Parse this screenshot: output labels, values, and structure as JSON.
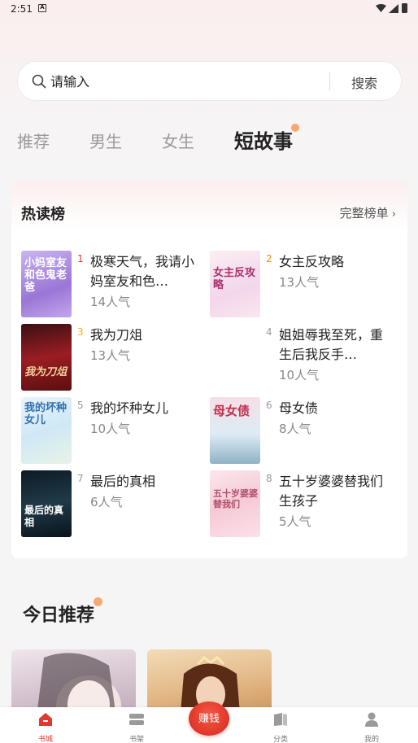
{
  "status_bar": {
    "time": "2:51",
    "notification_icon": "A"
  },
  "search": {
    "placeholder": "请输入",
    "button_label": "搜索"
  },
  "tabs": [
    {
      "label": "推荐",
      "active": false
    },
    {
      "label": "男生",
      "active": false
    },
    {
      "label": "女生",
      "active": false
    },
    {
      "label": "短故事",
      "active": true
    }
  ],
  "hot_list": {
    "title": "热读榜",
    "more_label": "完整榜单",
    "items": [
      {
        "rank": "1",
        "title": "极寒天气，我请小妈室友和色…",
        "popularity": "14人气",
        "cover_text": "小妈室友 和色鬼老爸",
        "rank_color": "#e03a2e"
      },
      {
        "rank": "2",
        "title": "女主反攻略",
        "popularity": "13人气",
        "cover_text": "女主反攻略",
        "rank_color": "#f08c1e"
      },
      {
        "rank": "3",
        "title": "我为刀俎",
        "popularity": "13人气",
        "cover_text": "我为刀俎",
        "rank_color": "#f0b41e"
      },
      {
        "rank": "4",
        "title": "姐姐辱我至死，重生后我反手…",
        "popularity": "10人气",
        "cover_text": "",
        "rank_color": "#999999"
      },
      {
        "rank": "5",
        "title": "我的坏种女儿",
        "popularity": "10人气",
        "cover_text": "我的坏种女儿",
        "rank_color": "#999999"
      },
      {
        "rank": "6",
        "title": "母女债",
        "popularity": "8人气",
        "cover_text": "母女债",
        "rank_color": "#999999"
      },
      {
        "rank": "7",
        "title": "最后的真相",
        "popularity": "6人气",
        "cover_text": "最后的真相",
        "rank_color": "#999999"
      },
      {
        "rank": "8",
        "title": "五十岁婆婆替我们生孩子",
        "popularity": "5人气",
        "cover_text": "五十岁婆婆 替我们",
        "rank_color": "#999999"
      }
    ]
  },
  "today": {
    "title": "今日推荐"
  },
  "bottom_nav": {
    "items": [
      {
        "label": "书城",
        "icon": "store-icon",
        "active": true
      },
      {
        "label": "书架",
        "icon": "bookshelf-icon",
        "active": false
      },
      {
        "label": "分类",
        "icon": "category-icon",
        "active": false
      },
      {
        "label": "我的",
        "icon": "profile-icon",
        "active": false
      }
    ],
    "earn_label": "赚钱"
  },
  "colors": {
    "accent": "#e03a2e",
    "tab_dot": "#f6a872"
  }
}
